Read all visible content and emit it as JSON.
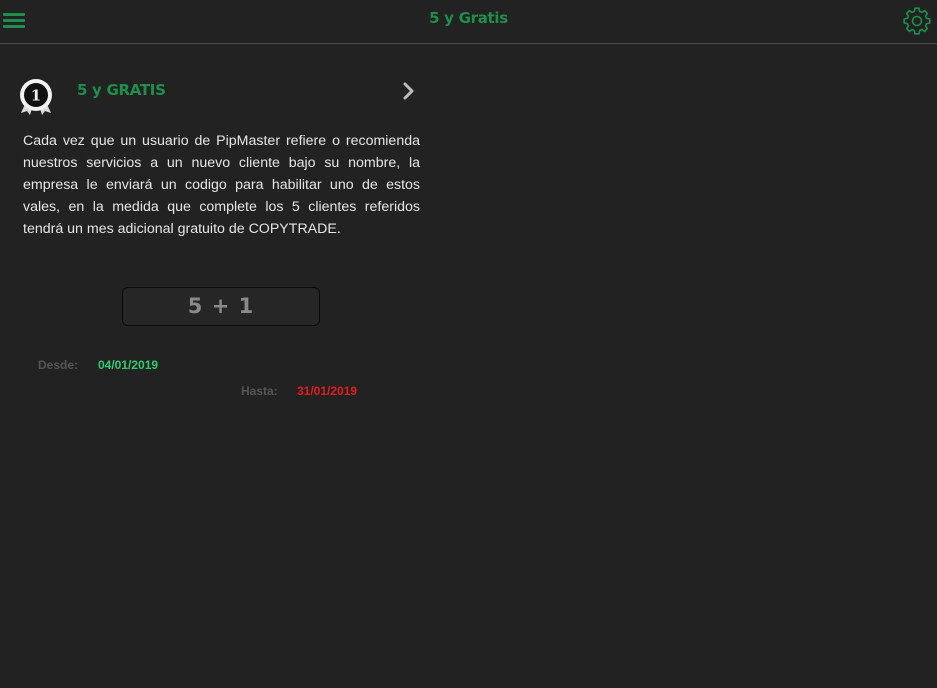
{
  "header": {
    "title": "5 y Gratis",
    "menu_icon": "hamburger-menu-icon",
    "settings_icon": "gear-icon"
  },
  "card": {
    "badge_icon": "award-ribbon-icon",
    "badge_number": "1",
    "title": "5 y GRATIS",
    "chevron_icon": "chevron-right-icon",
    "description": "Cada vez que un usuario de PipMaster refiere o recomienda nuestros servicios a un nuevo cliente bajo su nombre, la empresa le enviará un codigo para habilitar uno de estos vales, en la medida que complete los 5 clientes referidos tendrá un mes adicional gratuito de COPYTRADE.",
    "code": "5 + 1",
    "from_label": "Desde:",
    "from_value": "04/01/2019",
    "to_label": "Hasta:",
    "to_value": "31/01/2019"
  },
  "colors": {
    "background": "#222222",
    "accent_green": "#1e8f4b",
    "from_date": "#2ecc71",
    "to_date": "#e41b1b",
    "text": "#e6e6e6",
    "muted_label": "#555555"
  }
}
